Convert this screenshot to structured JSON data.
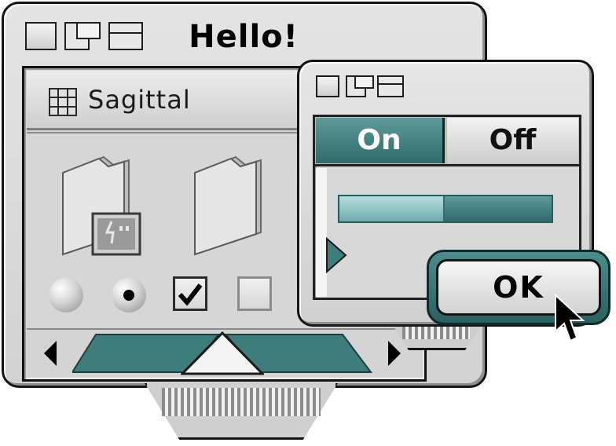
{
  "main_window": {
    "title": "Hello!",
    "view_selector": {
      "label": "Sagittal",
      "icon": "grid-icon"
    },
    "icons": [
      {
        "name": "finder-folder-icon"
      },
      {
        "name": "folder-icon"
      }
    ],
    "controls": {
      "radio_1": {
        "selected": false
      },
      "radio_2": {
        "selected": true
      },
      "checkbox_1": {
        "checked": true
      },
      "checkbox_2": {
        "checked": false
      }
    },
    "slider": {
      "value": 0.5
    }
  },
  "dialog_window": {
    "segments": [
      {
        "label": "On",
        "selected": true
      },
      {
        "label": "Off",
        "selected": false
      }
    ],
    "progress": {
      "value": 0.48
    },
    "ok_button": {
      "label": "OK"
    }
  },
  "colors": {
    "accent": "#3f7d7d",
    "accent_light": "#a6d2d2",
    "chrome": "#d4d4d4",
    "outline": "#141414"
  }
}
